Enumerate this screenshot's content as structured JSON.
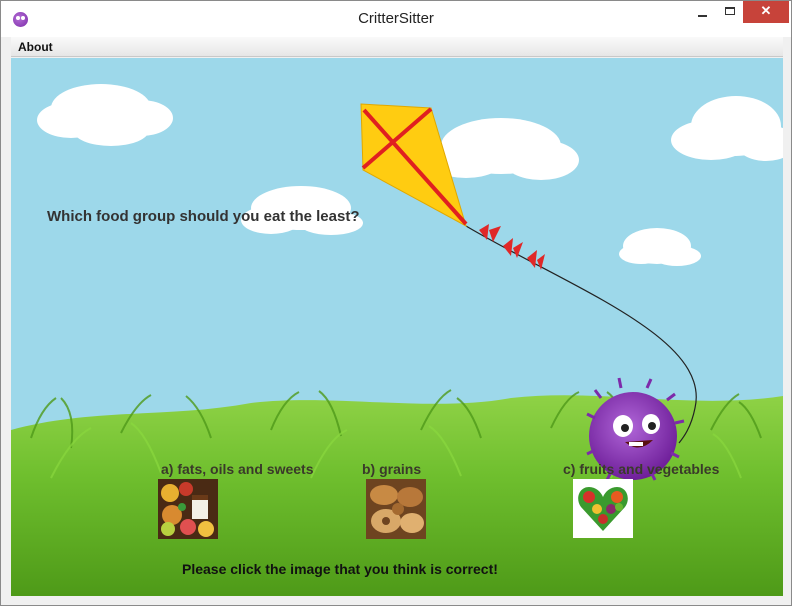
{
  "window": {
    "title": "CritterSitter",
    "controls": {
      "minimize": "minimize",
      "maximize": "maximize",
      "close": "✕"
    }
  },
  "menu": {
    "items": [
      "About"
    ]
  },
  "quiz": {
    "question": "Which food group should you eat the least?",
    "options": [
      {
        "label": "a) fats, oils and sweets",
        "image": "fats-oils-sweets-photo"
      },
      {
        "label": "b) grains",
        "image": "grains-bread-photo"
      },
      {
        "label": "c) fruits and vegetables",
        "image": "fruit-vegetable-heart-photo"
      }
    ],
    "instruction": "Please click the image that you think is correct!"
  },
  "scene": {
    "sky_color": "#9dd8ea",
    "grass_color": "#6fbf2e",
    "kite_color": "#ffcc11",
    "critter_color": "#8e3ab8"
  }
}
